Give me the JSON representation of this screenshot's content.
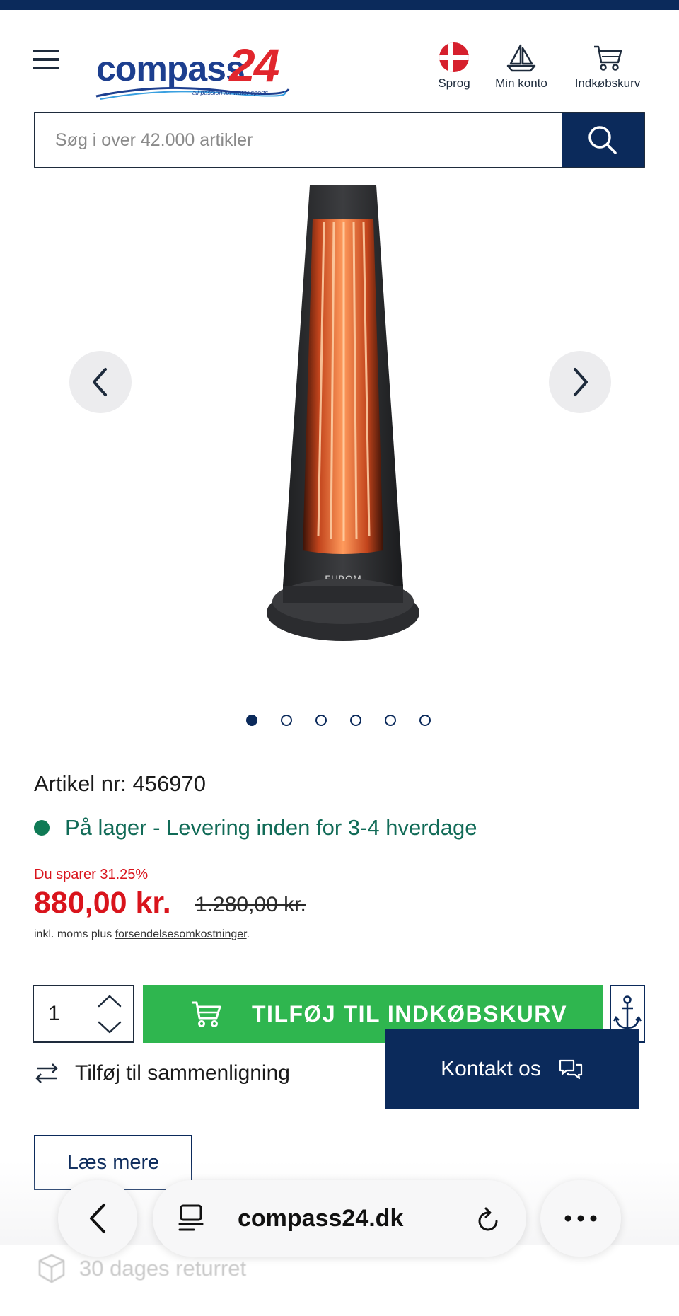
{
  "header": {
    "logo_word": "compass",
    "logo_number": "24",
    "logo_tagline": "all passion for water sports",
    "actions": [
      {
        "icon": "danish-flag-icon",
        "label": "Sprog"
      },
      {
        "icon": "sailboat-icon",
        "label": "Min konto"
      },
      {
        "icon": "cart-icon",
        "label": "Indkøbskurv"
      }
    ]
  },
  "search": {
    "placeholder": "Søg i over 42.000 artikler"
  },
  "gallery": {
    "brand_label": "EUROM",
    "image_count": 6,
    "active_index": 0
  },
  "product": {
    "article_number": "Artikel nr: 456970",
    "stock_status": "På lager - Levering inden for 3-4 hverdage",
    "savings": "Du sparer 31.25%",
    "price": "880,00 kr.",
    "old_price": "1.280,00 kr.",
    "vat_prefix": "inkl. moms plus ",
    "vat_link": "forsendelsesomkostninger",
    "vat_suffix": "."
  },
  "purchase": {
    "quantity": "1",
    "add_to_cart_label": "TILFØJ TIL INDKØBSKURV",
    "compare_label": "Tilføj til sammenligning",
    "read_more_label": "Læs mere"
  },
  "contact": {
    "label": "Kontakt os"
  },
  "benefits": {
    "returns": "30 dages returret"
  },
  "browser": {
    "url": "compass24.dk"
  },
  "colors": {
    "navy": "#0b2a5b",
    "green_button": "#2fb64f",
    "price_red": "#d9141c",
    "stock_green": "#116b57"
  }
}
